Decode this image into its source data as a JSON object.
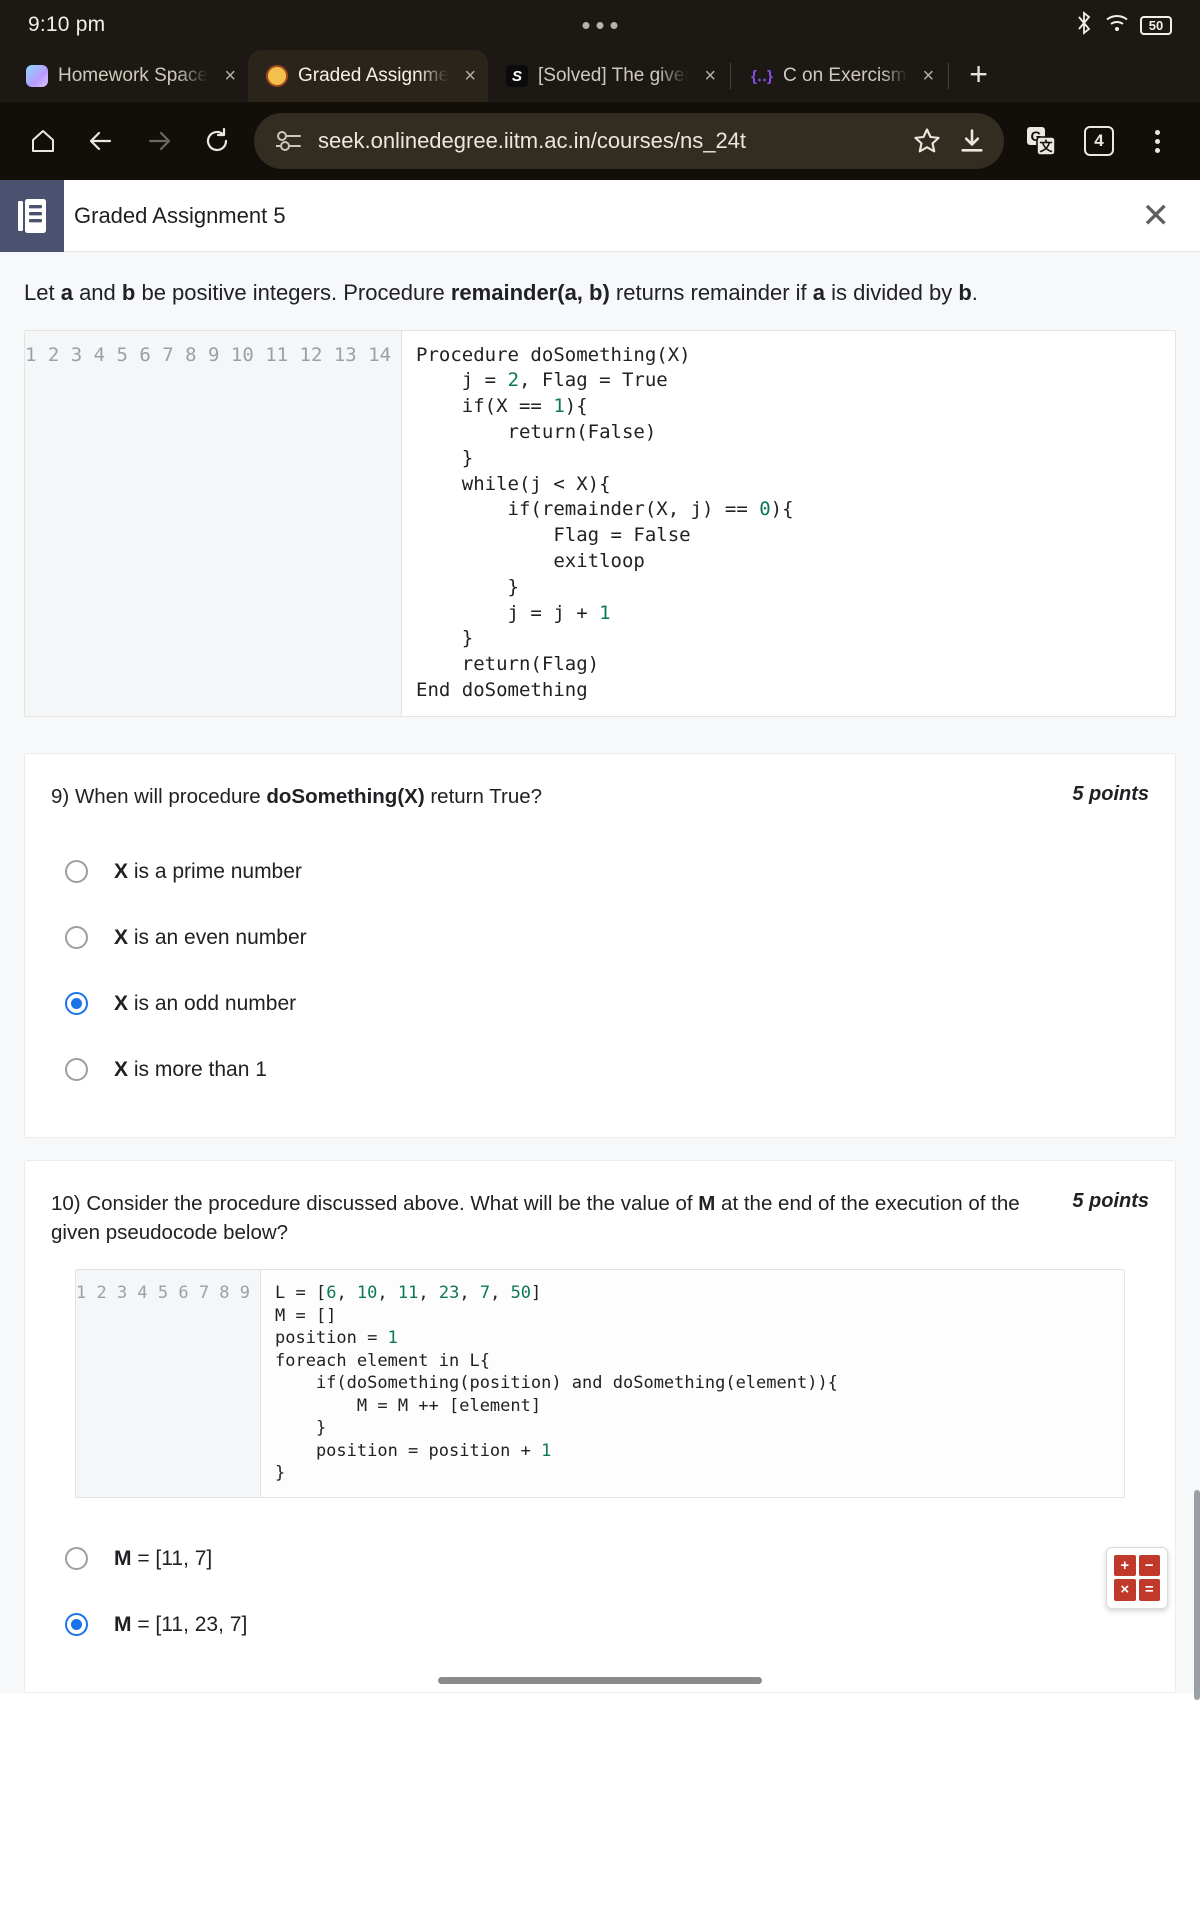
{
  "status": {
    "time": "9:10 pm",
    "battery": "50",
    "bluetooth_icon": "bluetooth-icon",
    "wifi_icon": "wifi-icon"
  },
  "tabs": [
    {
      "title": "Homework Space -",
      "favicon": "homework-space-icon",
      "active": false,
      "close": "×"
    },
    {
      "title": "Graded Assignmen",
      "favicon": "graded-assignment-icon",
      "active": true,
      "close": "×"
    },
    {
      "title": "[Solved] The given",
      "favicon": "solved-icon",
      "active": false,
      "close": "×"
    },
    {
      "title": "C on Exercism",
      "favicon": "exercism-icon",
      "active": false,
      "close": "×"
    }
  ],
  "newtab_label": "+",
  "toolbar": {
    "home_icon": "home-icon",
    "back_icon": "back-arrow-icon",
    "forward_icon": "forward-arrow-icon",
    "reload_icon": "reload-icon",
    "site_info_icon": "site-settings-icon",
    "url": "seek.onlinedegree.iitm.ac.in/courses/ns_24t",
    "bookmark_icon": "star-icon",
    "download_icon": "download-icon",
    "translate_icon": "translate-icon",
    "tab_count": "4",
    "menu_icon": "kebab-menu-icon"
  },
  "page_header": {
    "doc_icon": "document-icon",
    "title": "Graded Assignment 5",
    "close_label": "✕"
  },
  "intro": {
    "part1": "Let ",
    "a": "a",
    "part2": " and ",
    "b": "b",
    "part3": " be positive integers. Procedure ",
    "proc": "remainder(a, b)",
    "part4": " returns remainder if ",
    "a2": "a",
    "part5": " is divided by ",
    "b2": "b",
    "part6": "."
  },
  "code_main": {
    "line_numbers": "1\n2\n3\n4\n5\n6\n7\n8\n9\n10\n11\n12\n13\n14",
    "lines": [
      {
        "text": "Procedure doSomething(X)"
      },
      {
        "text": "    j = 2, Flag = True"
      },
      {
        "text": "    if(X == 1){"
      },
      {
        "text": "        return(False)"
      },
      {
        "text": "    }"
      },
      {
        "text": "    while(j < X){"
      },
      {
        "text": "        if(remainder(X, j) == 0){"
      },
      {
        "text": "            Flag = False"
      },
      {
        "text": "            exitloop"
      },
      {
        "text": "        }"
      },
      {
        "text": "        j = j + 1"
      },
      {
        "text": "    }"
      },
      {
        "text": "    return(Flag)"
      },
      {
        "text": "End doSomething"
      }
    ]
  },
  "question9": {
    "number": "9)",
    "text_before": "When will procedure ",
    "bold": "doSomething(X)",
    "text_after": " return True?",
    "points": "5 points",
    "options": [
      {
        "var": "X",
        "rest": " is a prime number",
        "selected": false
      },
      {
        "var": "X",
        "rest": " is an even number",
        "selected": false
      },
      {
        "var": "X",
        "rest": " is an odd number",
        "selected": true
      },
      {
        "var": "X",
        "rest": " is more than 1",
        "selected": false
      }
    ]
  },
  "question10": {
    "number": "10)",
    "text_before": "Consider the procedure discussed above. What will be the value of ",
    "bold": "M",
    "text_after": " at the end of the execution of the given pseudocode below?",
    "points": "5 points",
    "code": {
      "line_numbers": "1\n2\n3\n4\n5\n6\n7\n8\n9",
      "lines": [
        {
          "text": "L = [6, 10, 11, 23, 7, 50]"
        },
        {
          "text": "M = []"
        },
        {
          "text": "position = 1"
        },
        {
          "text": "foreach element in L{"
        },
        {
          "text": "    if(doSomething(position) and doSomething(element)){"
        },
        {
          "text": "        M = M ++ [element]"
        },
        {
          "text": "    }"
        },
        {
          "text": "    position = position + 1"
        },
        {
          "text": "}"
        }
      ]
    },
    "options": [
      {
        "var": "M",
        "rest": " = [11, 7]",
        "selected": false
      },
      {
        "var": "M",
        "rest": " = [11, 23, 7]",
        "selected": true
      }
    ]
  },
  "calculator_widget": {
    "keys": [
      "+",
      "−",
      "×",
      "="
    ]
  },
  "colors": {
    "accent_blue": "#1a73e8",
    "header_badge": "#4b5270",
    "code_number_green": "#0b7a52",
    "chrome_dark": "#1c1813"
  }
}
